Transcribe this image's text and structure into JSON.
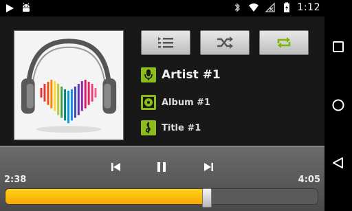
{
  "status_bar": {
    "left_icons": [
      "play-icon",
      "android-icon"
    ],
    "right_icons": [
      "bluetooth-icon",
      "wifi-icon",
      "no-signal-icon",
      "battery-charging-icon"
    ],
    "time": "1:12"
  },
  "album_art": {
    "description_icon": "headphones-heart-icon"
  },
  "toolbar": {
    "buttons": [
      {
        "name": "playlist",
        "icon": "playlist-icon"
      },
      {
        "name": "shuffle",
        "icon": "shuffle-icon"
      },
      {
        "name": "repeat",
        "icon": "repeat-icon",
        "active_color": "#7ab800"
      }
    ]
  },
  "track": {
    "artist": "Artist #1",
    "album": "Album #1",
    "title": "Title #1",
    "tag_color": "#8bbd1a"
  },
  "player": {
    "current_time": "2:38",
    "total_time": "4:05",
    "progress_fraction": 0.645,
    "progress_color": "#ffc400"
  },
  "nav_bar": {
    "buttons": [
      "recent-apps-icon",
      "home-icon",
      "back-icon"
    ]
  }
}
